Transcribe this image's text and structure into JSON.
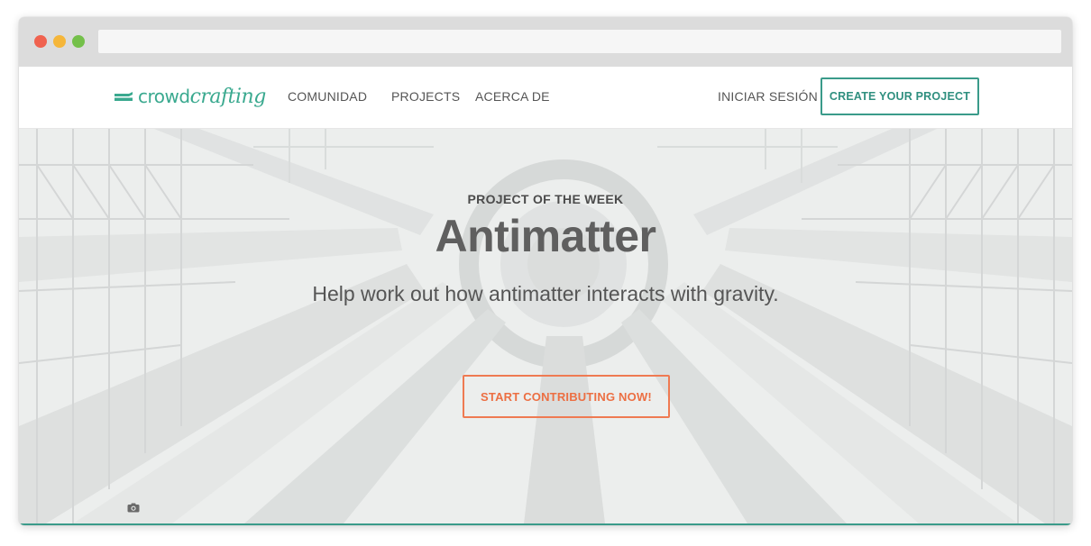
{
  "browser": {
    "address": ""
  },
  "brand": {
    "part1": "crowd",
    "part2": "crafting",
    "color": "#3aa98f"
  },
  "nav": {
    "links": [
      "COMUNIDAD",
      "PROJECTS",
      "ACERCA DE"
    ],
    "login": "INICIAR SESIÓN",
    "cta": "CREATE YOUR PROJECT",
    "cta_color": "#3a9b8a"
  },
  "hero": {
    "eyebrow": "PROJECT OF THE WEEK",
    "title": "Antimatter",
    "description": "Help work out how antimatter interacts with gravity.",
    "cta": "START CONTRIBUTING NOW!",
    "cta_color": "#ec6f43",
    "photo_icon": "camera-icon"
  }
}
